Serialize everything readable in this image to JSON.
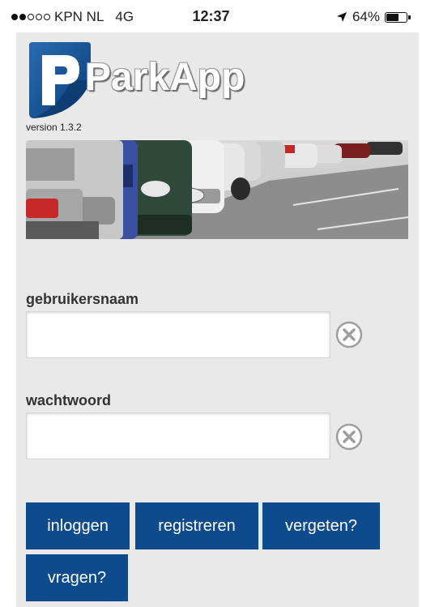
{
  "status_bar": {
    "carrier": "KPN NL",
    "network": "4G",
    "time": "12:37",
    "battery_percent": "64%",
    "battery_level": 0.64,
    "signal_bars_filled": 2,
    "signal_bars_total": 5,
    "icons": [
      "signal-dots-icon",
      "location-arrow-icon",
      "battery-icon"
    ]
  },
  "app": {
    "title": "ParkApp",
    "version": "version 1.3.2",
    "logo_icon": "parkapp-logo-icon",
    "banner_image": "parked-cars-photo"
  },
  "form": {
    "username_label": "gebruikersnaam",
    "username_value": "",
    "password_label": "wachtwoord",
    "password_value": "",
    "clear_icon": "clear-circle-icon"
  },
  "buttons": {
    "login": "inloggen",
    "register": "registreren",
    "forgot": "vergeten?",
    "questions": "vragen?"
  },
  "colors": {
    "app_background": "#e9e9e9",
    "button_blue": "#0e4b8e",
    "logo_blue": "#14508f"
  }
}
